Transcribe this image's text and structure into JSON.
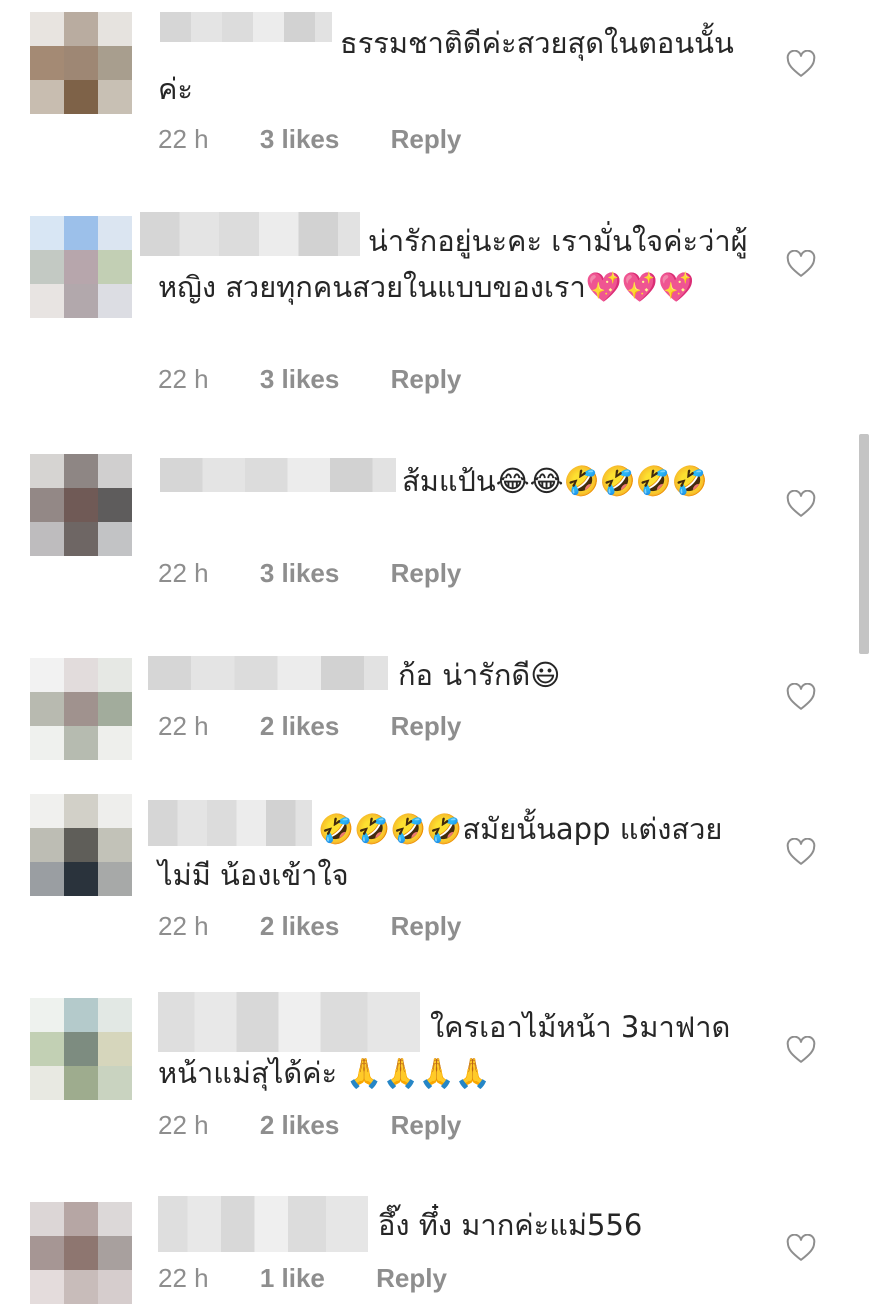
{
  "comments": [
    {
      "text": "ธรรมชาติดีค่ะสวยสุดในตอนนั้นค่ะ",
      "time": "22 h",
      "likes": "3 likes",
      "reply": "Reply",
      "avatar_colors": [
        "#e8e4e0",
        "#b9aca0",
        "#e6e3df",
        "#a48a74",
        "#9e8774",
        "#a89e8e",
        "#c8bdb0",
        "#7e6248",
        "#c8c0b4"
      ]
    },
    {
      "text": "น่ารักอยู่นะคะ เรามั่นใจค่ะว่าผู้หญิง สวยทุกคนสวยในแบบของเรา💖💖💖",
      "time": "22 h",
      "likes": "3 likes",
      "reply": "Reply",
      "avatar_colors": [
        "#d8e6f4",
        "#9cc0ea",
        "#dbe5f1",
        "#c3c9c3",
        "#b7a6ac",
        "#c2cfb4",
        "#e8e4e2",
        "#b2a8ac",
        "#dcdde3"
      ]
    },
    {
      "text": "ส้มแป้น😂😂🤣🤣🤣🤣",
      "time": "22 h",
      "likes": "3 likes",
      "reply": "Reply",
      "avatar_colors": [
        "#d6d4d2",
        "#8e8684",
        "#d0cfcf",
        "#938886",
        "#705a56",
        "#5e5c5c",
        "#bebcbe",
        "#6e6664",
        "#c2c3c5"
      ]
    },
    {
      "text": "ก้อ น่ารักดี😃",
      "time": "22 h",
      "likes": "2 likes",
      "reply": "Reply",
      "avatar_colors": [
        "#f2f2f2",
        "#e2dcdc",
        "#e6e8e4",
        "#b8bab0",
        "#a0928e",
        "#a2ac9c",
        "#eff1ee",
        "#b6bbb0",
        "#eeefec"
      ]
    },
    {
      "text": "🤣🤣🤣🤣สมัยนั้นapp แต่งสวยไม่มี น้องเข้าใจ",
      "time": "22 h",
      "likes": "2 likes",
      "reply": "Reply",
      "avatar_colors": [
        "#f0f0ee",
        "#d2d0c8",
        "#eeeeec",
        "#bdbdb4",
        "#5f5e59",
        "#c2c2b8",
        "#9a9ea2",
        "#2a333c",
        "#a7a9a8"
      ]
    },
    {
      "text": "ใครเอาไม้หน้า 3มาฟาดหน้าแม่สุได้ค่ะ 🙏🙏🙏🙏",
      "time": "22 h",
      "likes": "2 likes",
      "reply": "Reply",
      "avatar_colors": [
        "#eef2ee",
        "#b4cacb",
        "#e2e8e4",
        "#c2d0b4",
        "#7d8c80",
        "#d6d6bc",
        "#e8e9e2",
        "#9eac8e",
        "#c9d3c0"
      ]
    },
    {
      "text": "อึ๊ง ทึ๋ง มากค่ะแม่556",
      "time": "22 h",
      "likes": "1 like",
      "reply": "Reply",
      "avatar_colors": [
        "#dcd6d6",
        "#b6a6a4",
        "#dcd8d8",
        "#a69694",
        "#8e7670",
        "#a8a09e",
        "#e4dcdc",
        "#c8bcba",
        "#d6cdcd"
      ]
    }
  ]
}
